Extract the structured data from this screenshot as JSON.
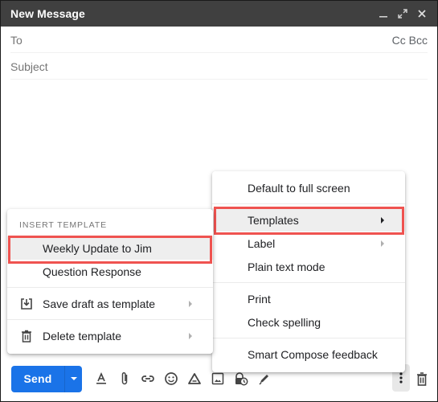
{
  "window": {
    "title": "New Message",
    "controls": {
      "minimize": "minimize-icon",
      "fullscreen": "expand-icon",
      "close": "close-icon"
    }
  },
  "fields": {
    "to_label": "To",
    "cc_bcc": "Cc Bcc",
    "subject_placeholder": "Subject"
  },
  "more_options_menu": {
    "items": [
      {
        "label": "Default to full screen",
        "has_submenu": false
      },
      {
        "label": "Templates",
        "has_submenu": true,
        "highlighted": true
      },
      {
        "label": "Label",
        "has_submenu": true
      },
      {
        "label": "Plain text mode",
        "has_submenu": false
      },
      {
        "label": "Print",
        "has_submenu": false
      },
      {
        "label": "Check spelling",
        "has_submenu": false
      },
      {
        "label": "Smart Compose feedback",
        "has_submenu": false
      }
    ]
  },
  "templates_menu": {
    "section_header": "INSERT TEMPLATE",
    "templates": [
      {
        "label": "Weekly Update to Jim",
        "highlighted": true
      },
      {
        "label": "Question Response"
      }
    ],
    "actions": [
      {
        "label": "Save draft as template",
        "icon": "save-template-icon",
        "has_submenu": true
      },
      {
        "label": "Delete template",
        "icon": "trash-icon",
        "has_submenu": true
      }
    ]
  },
  "toolbar": {
    "send_label": "Send",
    "tools": [
      "formatting-options-icon",
      "attach-file-icon",
      "insert-link-icon",
      "insert-emoji-icon",
      "google-drive-icon",
      "insert-photo-icon",
      "confidential-mode-icon",
      "signature-icon"
    ]
  },
  "colors": {
    "titlebar": "#404040",
    "send_button": "#1a73e8",
    "highlight_box": "#ef5350",
    "menu_hover": "#eeeeee"
  }
}
